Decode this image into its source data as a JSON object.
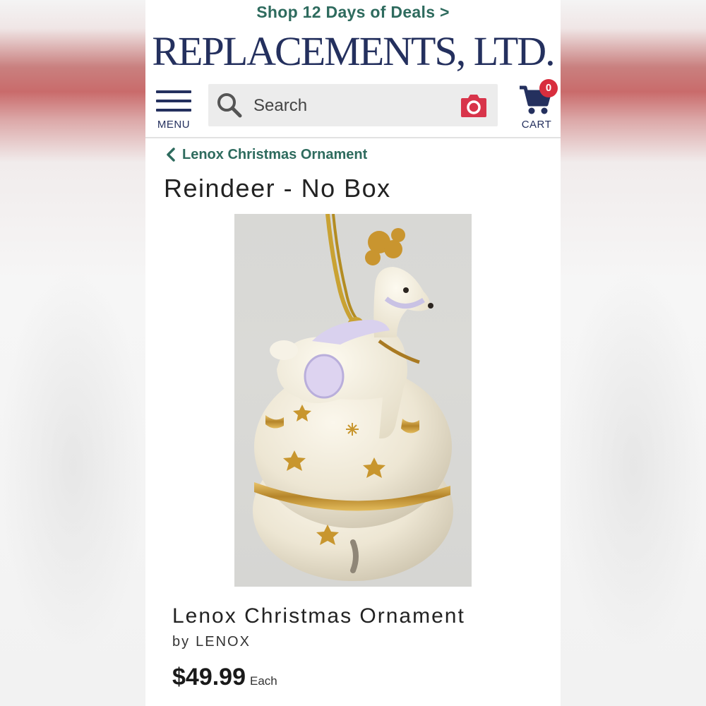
{
  "promo": {
    "text": "Shop 12 Days of Deals >"
  },
  "header": {
    "logo_text": "REPLACEMENTS, LTD.",
    "menu_label": "MENU",
    "cart_label": "CART",
    "cart_count": "0"
  },
  "search": {
    "placeholder": "Search"
  },
  "breadcrumb": {
    "label": "Lenox Christmas Ornament"
  },
  "product": {
    "title": "Reindeer - No Box",
    "name": "Lenox Christmas Ornament",
    "brand_prefix": "by",
    "brand": "LENOX",
    "price": "$49.99",
    "price_unit": "Each"
  },
  "colors": {
    "brand_navy": "#24305e",
    "promo_green": "#2e6b5e",
    "camera_red": "#d8344a",
    "badge_red": "#d82e3e"
  },
  "icons": [
    "menu-icon",
    "search-icon",
    "camera-icon",
    "cart-icon",
    "chevron-left-icon"
  ]
}
